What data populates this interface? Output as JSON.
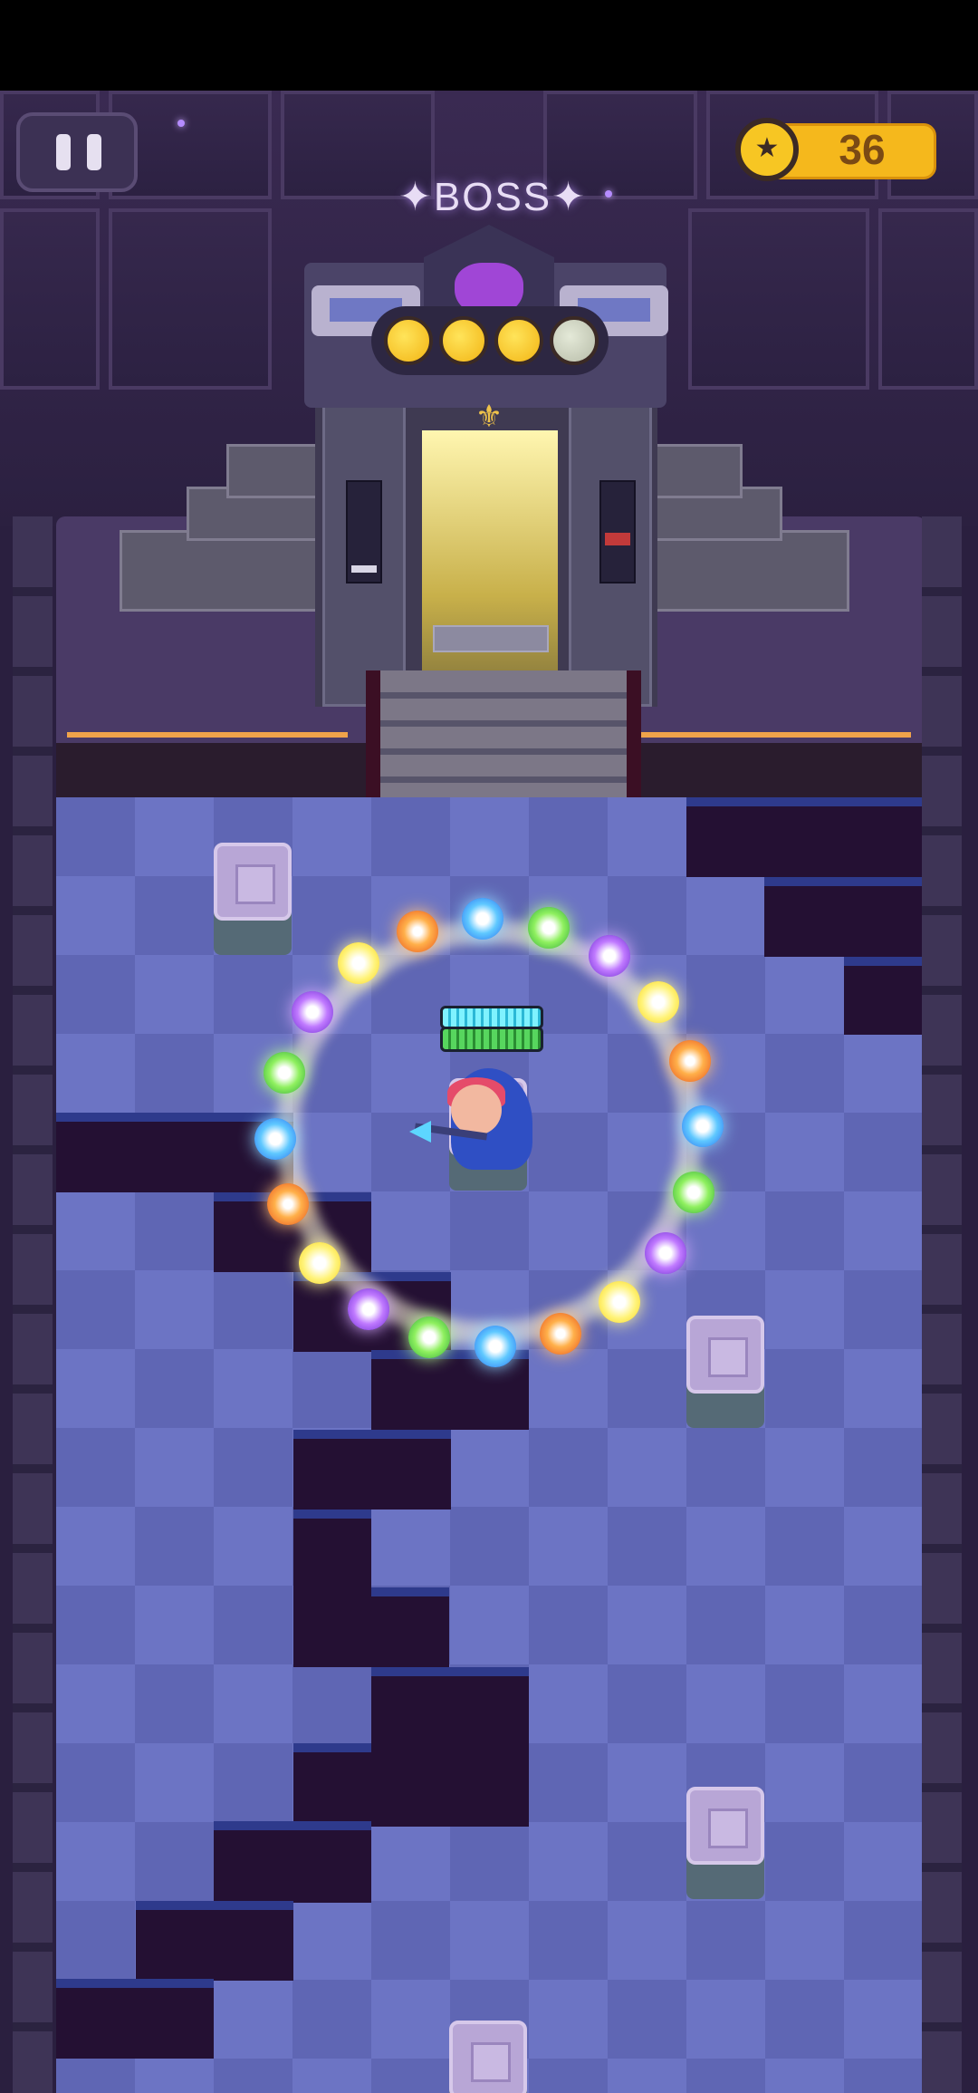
{
  "hud": {
    "pause_icon": "pause-icon",
    "coin_icon": "star-coin-icon",
    "coin_count": "36"
  },
  "boss": {
    "label": "✦BOSS✦",
    "emblem_icon": "demon-skull-icon",
    "lives": [
      {
        "state": "full"
      },
      {
        "state": "full"
      },
      {
        "state": "full"
      },
      {
        "state": "empty"
      }
    ],
    "crest_icon": "fleur-de-lis-icon"
  },
  "player": {
    "shield_level": 1.0,
    "health_level": 1.0
  },
  "orb_ring": {
    "colors": [
      "blue",
      "green",
      "purple",
      "yellow",
      "orange",
      "blue",
      "green",
      "purple",
      "yellow",
      "orange",
      "blue",
      "green",
      "purple",
      "yellow",
      "orange",
      "blue",
      "green",
      "purple",
      "yellow",
      "orange"
    ]
  },
  "palette": {
    "coin_gold": "#f5b81c",
    "gate_light": "#fff6b0",
    "floor_blue": "#5f66b4",
    "accent_orange": "#f0a34a"
  }
}
